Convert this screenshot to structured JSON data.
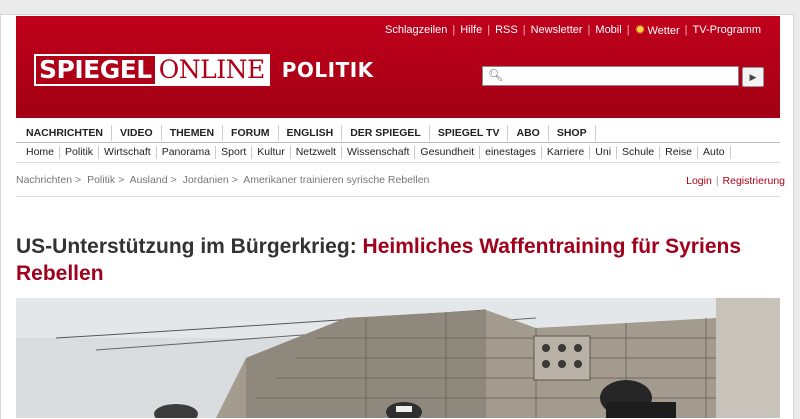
{
  "topnav": {
    "items": [
      "Schlagzeilen",
      "Hilfe",
      "RSS",
      "Newsletter",
      "Mobil",
      "Wetter",
      "TV-Programm"
    ]
  },
  "logo": {
    "spiegel": "SPIEGEL",
    "online": "ONLINE",
    "ressort": "POLITIK"
  },
  "search": {
    "placeholder": ""
  },
  "mainnav": [
    "NACHRICHTEN",
    "VIDEO",
    "THEMEN",
    "FORUM",
    "ENGLISH",
    "DER SPIEGEL",
    "SPIEGEL TV",
    "ABO",
    "SHOP"
  ],
  "subnav": [
    "Home",
    "Politik",
    "Wirtschaft",
    "Panorama",
    "Sport",
    "Kultur",
    "Netzwelt",
    "Wissenschaft",
    "Gesundheit",
    "einestages",
    "Karriere",
    "Uni",
    "Schule",
    "Reise",
    "Auto"
  ],
  "breadcrumb": [
    "Nachrichten",
    "Politik",
    "Ausland",
    "Jordanien",
    "Amerikaner trainieren syrische Rebellen"
  ],
  "account": {
    "login": "Login",
    "register": "Registrierung"
  },
  "article": {
    "kicker": "US-Unterstützung im Bürgerkrieg:",
    "title": "Heimliches Waffentraining für Syriens Rebellen"
  },
  "colors": {
    "brand_red": "#b00017",
    "headline_red": "#a0001b"
  }
}
